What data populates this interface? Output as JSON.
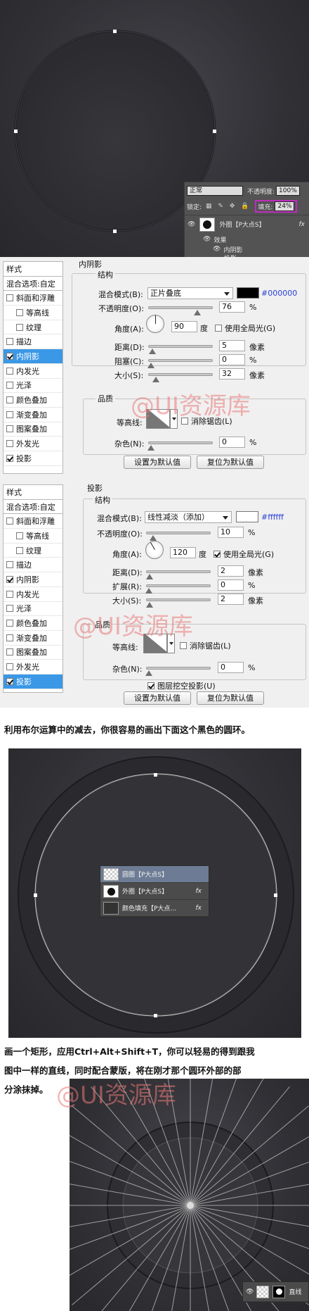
{
  "ps_layers_top": {
    "blend_mode": "正常",
    "opacity_label": "不透明度:",
    "opacity": "100%",
    "lock_label": "锁定:",
    "fill_label": "填充:",
    "fill": "24%",
    "layer_name": "外圈【P大点S】",
    "fx": "fx",
    "effects_label": "效果",
    "effect1": "内阴影",
    "effect2": "投影"
  },
  "dialog1": {
    "sidebar_title": "样式",
    "blend_options": "混合选项:自定",
    "items": [
      {
        "label": "斜面和浮雕",
        "checked": false,
        "sub": false,
        "active": false
      },
      {
        "label": "等高线",
        "checked": false,
        "sub": true,
        "active": false
      },
      {
        "label": "纹理",
        "checked": false,
        "sub": true,
        "active": false
      },
      {
        "label": "描边",
        "checked": false,
        "sub": false,
        "active": false
      },
      {
        "label": "内阴影",
        "checked": true,
        "sub": false,
        "active": true
      },
      {
        "label": "内发光",
        "checked": false,
        "sub": false,
        "active": false
      },
      {
        "label": "光泽",
        "checked": false,
        "sub": false,
        "active": false
      },
      {
        "label": "颜色叠加",
        "checked": false,
        "sub": false,
        "active": false
      },
      {
        "label": "渐变叠加",
        "checked": false,
        "sub": false,
        "active": false
      },
      {
        "label": "图案叠加",
        "checked": false,
        "sub": false,
        "active": false
      },
      {
        "label": "外发光",
        "checked": false,
        "sub": false,
        "active": false
      },
      {
        "label": "投影",
        "checked": true,
        "sub": false,
        "active": false
      }
    ],
    "section_title": "内阴影",
    "structure": "结构",
    "blend_mode_label": "混合模式(B):",
    "blend_mode": "正片叠底",
    "color": "#000000",
    "color_hex": "#000000",
    "opacity_label": "不透明度(O):",
    "opacity": "76",
    "percent": "%",
    "angle_label": "角度(A):",
    "angle": "90",
    "degree": "度",
    "global_light": "使用全局光(G)",
    "global_light_checked": false,
    "distance_label": "距离(D):",
    "distance": "5",
    "choke_label": "阻塞(C):",
    "choke": "0",
    "size_label": "大小(S):",
    "size": "32",
    "px": "像素",
    "quality": "品质",
    "contour_label": "等高线:",
    "antialias": "消除锯齿(L)",
    "noise_label": "杂色(N):",
    "noise": "0",
    "btn_default": "设置为默认值",
    "btn_reset": "复位为默认值"
  },
  "dialog2": {
    "sidebar_title": "样式",
    "blend_options": "混合选项:自定",
    "items": [
      {
        "label": "斜面和浮雕",
        "checked": false,
        "sub": false,
        "active": false
      },
      {
        "label": "等高线",
        "checked": false,
        "sub": true,
        "active": false
      },
      {
        "label": "纹理",
        "checked": false,
        "sub": true,
        "active": false
      },
      {
        "label": "描边",
        "checked": false,
        "sub": false,
        "active": false
      },
      {
        "label": "内阴影",
        "checked": true,
        "sub": false,
        "active": false
      },
      {
        "label": "内发光",
        "checked": false,
        "sub": false,
        "active": false
      },
      {
        "label": "光泽",
        "checked": false,
        "sub": false,
        "active": false
      },
      {
        "label": "颜色叠加",
        "checked": false,
        "sub": false,
        "active": false
      },
      {
        "label": "渐变叠加",
        "checked": false,
        "sub": false,
        "active": false
      },
      {
        "label": "图案叠加",
        "checked": false,
        "sub": false,
        "active": false
      },
      {
        "label": "外发光",
        "checked": false,
        "sub": false,
        "active": false
      },
      {
        "label": "投影",
        "checked": true,
        "sub": false,
        "active": true
      }
    ],
    "section_title": "投影",
    "structure": "结构",
    "blend_mode_label": "混合模式(B):",
    "blend_mode": "线性减淡（添加）",
    "color": "#ffffff",
    "color_hex": "#ffffff",
    "opacity_label": "不透明度(O):",
    "opacity": "10",
    "percent": "%",
    "angle_label": "角度(A):",
    "angle": "120",
    "degree": "度",
    "global_light": "使用全局光(G)",
    "global_light_checked": true,
    "distance_label": "距离(D):",
    "distance": "2",
    "spread_label": "扩展(R):",
    "spread": "0",
    "size_label": "大小(S):",
    "size": "2",
    "px": "像素",
    "quality": "品质",
    "contour_label": "等高线:",
    "antialias": "消除锯齿(L)",
    "noise_label": "杂色(N):",
    "noise": "0",
    "knockout": "图层挖空投影(U)",
    "btn_default": "设置为默认值",
    "btn_reset": "复位为默认值"
  },
  "watermark": "@UI资源库",
  "text1": "利用布尔运算中的减去，你很容易的画出下面这个黑色的圆环。",
  "mini_layers": {
    "row1": "圆圈【P大点S】",
    "row2": "外圈【P大点S】",
    "row3": "颜色填充【P大点...",
    "fx": "fx"
  },
  "text2_line1": "画一个矩形，应用Ctrl+Alt+Shift+T，你可以轻易的得到跟我",
  "text2_line2": "图中一样的直线，同时配合蒙版，将在刚才那个圆环外部的部",
  "text2_line3": "分涂抹掉。",
  "bottom_layers": {
    "row1": "直线"
  }
}
